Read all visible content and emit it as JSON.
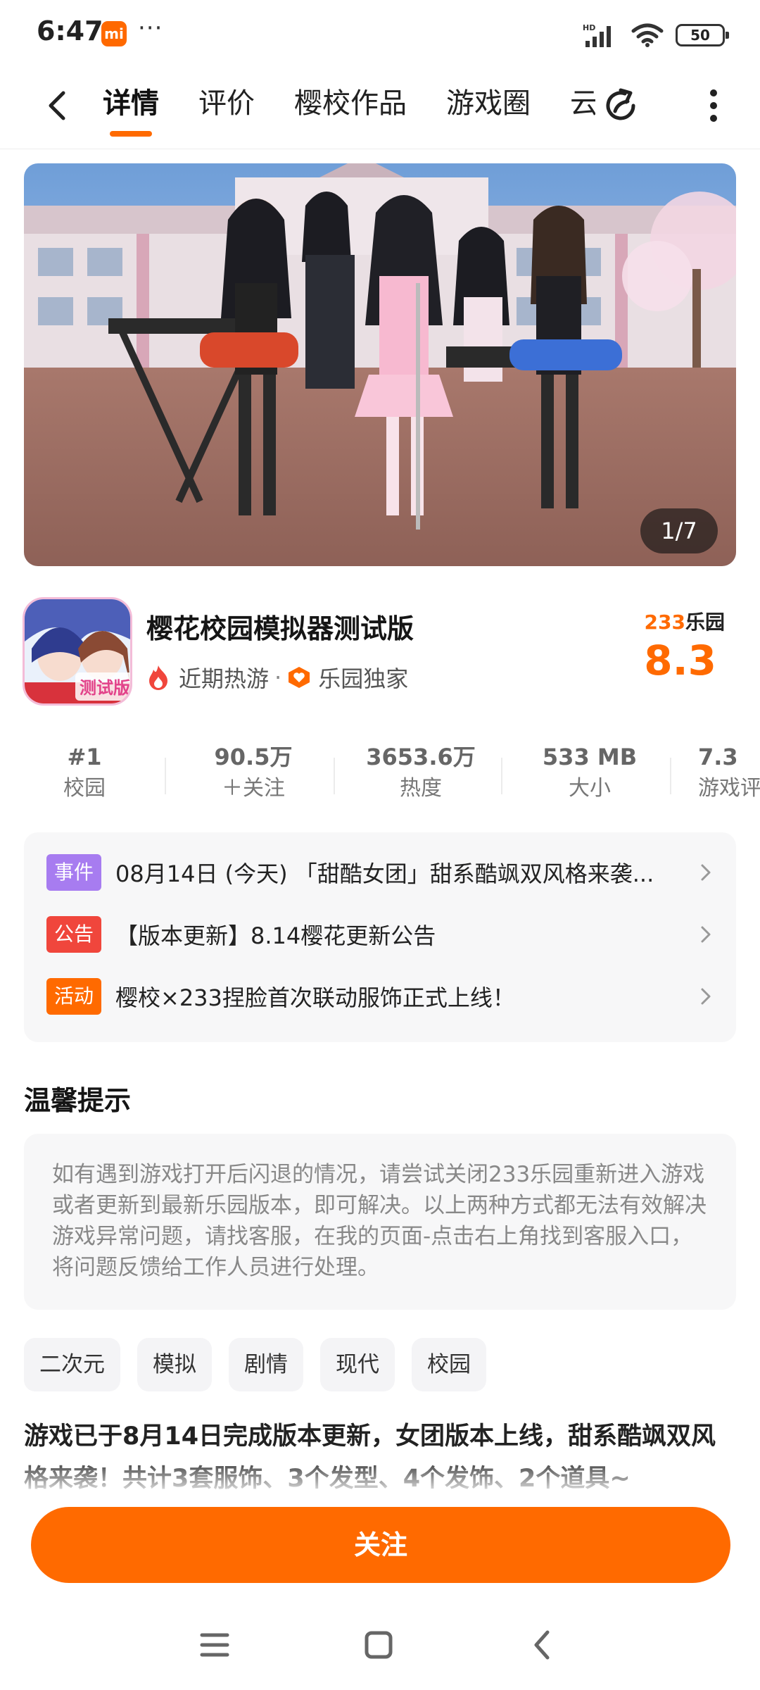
{
  "status_bar": {
    "time": "6:47",
    "mi_badge": "mi",
    "dots": "···",
    "network": "HD",
    "battery": "50"
  },
  "nav": {
    "tabs": [
      {
        "label": "详情",
        "active": true
      },
      {
        "label": "评价",
        "active": false
      },
      {
        "label": "樱校作品",
        "active": false
      },
      {
        "label": "游戏圈",
        "active": false
      },
      {
        "label": "云",
        "active": false
      }
    ]
  },
  "banner": {
    "counter": "1/7"
  },
  "app": {
    "name": "樱花校园模拟器测试版",
    "icon_text": "测试版",
    "tag_hot": "近期热游",
    "tag_sep": "·",
    "tag_exclusive": "乐园独家",
    "score_brand_num": "233",
    "score_brand_cn": "乐园",
    "score": "8.3"
  },
  "stats": [
    {
      "value": "#1",
      "label": "校园"
    },
    {
      "value": "90.5万",
      "label": "＋关注"
    },
    {
      "value": "3653.6万",
      "label": "热度"
    },
    {
      "value": "533 MB",
      "label": "大小"
    },
    {
      "value": "7.3",
      "label": "游戏评"
    }
  ],
  "notices": [
    {
      "badge": "事件",
      "color": "#a77cf0",
      "text": "08月14日 (今天) 「甜酷女团」甜系酷飒双风格来袭..."
    },
    {
      "badge": "公告",
      "color": "#f0463c",
      "text": "【版本更新】8.14樱花更新公告"
    },
    {
      "badge": "活动",
      "color": "#ff6a00",
      "text": "樱校×233捏脸首次联动服饰正式上线！"
    }
  ],
  "tips": {
    "title": "温馨提示",
    "body": "如有遇到游戏打开后闪退的情况，请尝试关闭233乐园重新进入游戏或者更新到最新乐园版本，即可解决。以上两种方式都无法有效解决游戏异常问题，请找客服，在我的页面-点击右上角找到客服入口，将问题反馈给工作人员进行处理。"
  },
  "chips": [
    "二次元",
    "模拟",
    "剧情",
    "现代",
    "校园"
  ],
  "description": "游戏已于8月14日完成版本更新，女团版本上线，甜系酷飒双风格来袭！共计3套服饰、3个发型、4个发饰、2个道具~",
  "follow_button": "关注",
  "colors": {
    "accent": "#ff6a00",
    "event": "#a77cf0",
    "announce": "#f0463c",
    "activity": "#ff6a00"
  }
}
